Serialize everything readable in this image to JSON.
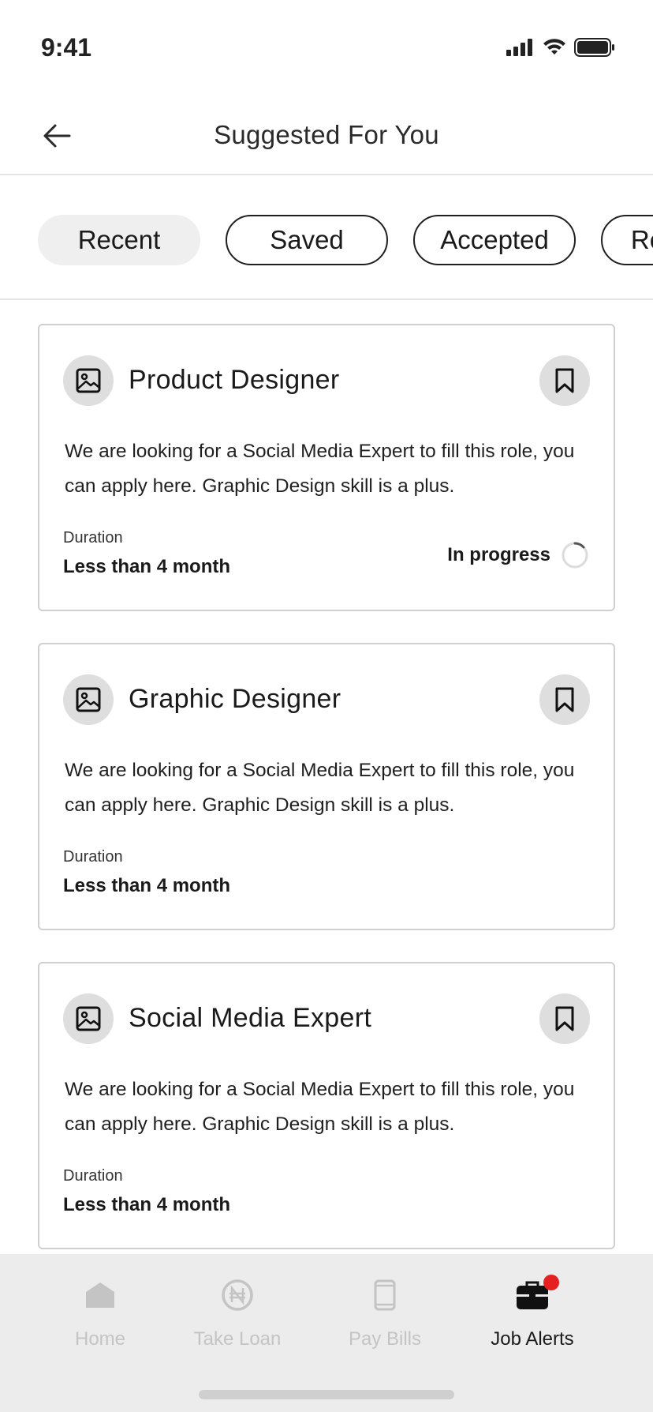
{
  "status_bar": {
    "time": "9:41"
  },
  "header": {
    "title": "Suggested For You"
  },
  "tabs": [
    {
      "label": "Recent",
      "active": true
    },
    {
      "label": "Saved",
      "active": false
    },
    {
      "label": "Accepted",
      "active": false
    },
    {
      "label": "Rejected",
      "active": false
    }
  ],
  "cards": [
    {
      "title": "Product Designer",
      "description": "We are looking for a Social Media Expert to fill this role, you can apply here. Graphic Design skill is a plus.",
      "duration_label": "Duration",
      "duration_value": "Less than 4 month",
      "status": "In progress"
    },
    {
      "title": "Graphic Designer",
      "description": "We are looking for a Social Media Expert to fill this role, you can apply here. Graphic Design skill is a plus.",
      "duration_label": "Duration",
      "duration_value": "Less than 4 month"
    },
    {
      "title": "Social Media Expert",
      "description": "We are looking for a Social Media Expert to fill this role, you can apply here. Graphic Design skill is a plus.",
      "duration_label": "Duration",
      "duration_value": "Less than 4 month"
    }
  ],
  "bottom_nav": [
    {
      "label": "Home",
      "icon": "home-icon",
      "active": false
    },
    {
      "label": "Take Loan",
      "icon": "naira-coin-icon",
      "active": false
    },
    {
      "label": "Pay Bills",
      "icon": "phone-icon",
      "active": false
    },
    {
      "label": "Job Alerts",
      "icon": "briefcase-icon",
      "active": true
    }
  ],
  "colors": {
    "accent": "#1a1a1a",
    "notification": "#e62020",
    "inactive": "#c4c4c4"
  }
}
